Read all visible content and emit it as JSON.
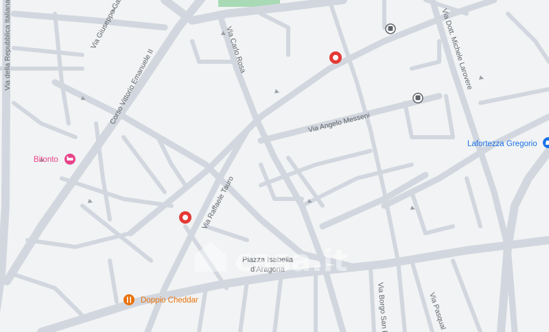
{
  "map": {
    "colors": {
      "background": "#f1f3f4",
      "road": "#d2d7df",
      "park": "#a8dab5",
      "label": "#5f6368",
      "pin": "#e53935",
      "hotel": "#e8438a",
      "restaurant": "#e8710a",
      "shop": "#1a73e8"
    },
    "streets": [
      "Via della Repubblica Italiana",
      "Via Giuseppe Gar",
      "Corso Vittorio Emanuele II",
      "Via Carlo Rosa",
      "Via Angelo Messeni",
      "Via Dott. Michele Larovere",
      "Via Raffaele Tauro",
      "Via Borgo San F",
      "Via Pasqual"
    ],
    "place": [
      "Piazza Isabella",
      "d'Aragona"
    ],
    "pois": [
      {
        "name": "Bitonto",
        "icon": "hotel-icon"
      },
      {
        "name": "Doppio Cheddar",
        "icon": "restaurant-icon"
      },
      {
        "name": "Lafortezza Gregorio",
        "icon": "shop-icon"
      }
    ],
    "markers": [
      "location-pin-icon",
      "location-pin-icon"
    ],
    "transit_icons": [
      "bus-stop-icon",
      "bus-stop-icon"
    ],
    "watermark": "casa.it"
  }
}
